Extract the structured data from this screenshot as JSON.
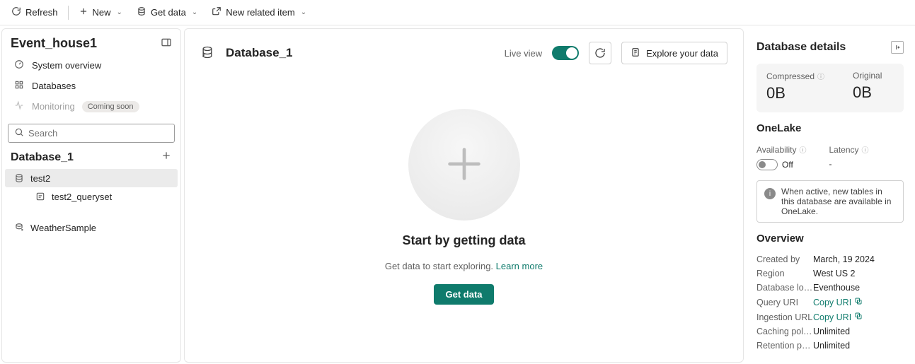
{
  "toolbar": {
    "refresh": "Refresh",
    "new": "New",
    "get_data": "Get data",
    "new_related": "New related item"
  },
  "left": {
    "title": "Event_house1",
    "nav": {
      "system_overview": "System overview",
      "databases": "Databases",
      "monitoring": "Monitoring",
      "monitoring_pill": "Coming soon"
    },
    "search_placeholder": "Search",
    "db_title": "Database_1",
    "tree": {
      "item1": "test2",
      "item1_child": "test2_queryset",
      "item2": "WeatherSample"
    }
  },
  "center": {
    "title": "Database_1",
    "live_view": "Live view",
    "explore": "Explore your data",
    "body_title": "Start by getting data",
    "body_sub_pre": "Get data to start exploring. ",
    "body_sub_link": "Learn more",
    "cta": "Get data"
  },
  "right": {
    "title": "Database details",
    "compressed_label": "Compressed",
    "compressed_val": "0B",
    "original_label": "Original",
    "original_val": "0B",
    "onelake_title": "OneLake",
    "availability_label": "Availability",
    "availability_val": "Off",
    "latency_label": "Latency",
    "latency_val": "-",
    "info_text": "When active, new tables in this database are available in OneLake.",
    "overview_title": "Overview",
    "kv": {
      "created_by_k": "Created by",
      "created_by_v": "March, 19 2024",
      "region_k": "Region",
      "region_v": "West US 2",
      "db_loc_k": "Database locati…",
      "db_loc_v": "Eventhouse",
      "query_uri_k": "Query URI",
      "query_uri_v": "Copy URI",
      "ingest_url_k": "Ingestion URL",
      "ingest_url_v": "Copy URI",
      "caching_k": "Caching policy",
      "caching_v": "Unlimited",
      "retention_k": "Retention policy",
      "retention_v": "Unlimited"
    }
  }
}
